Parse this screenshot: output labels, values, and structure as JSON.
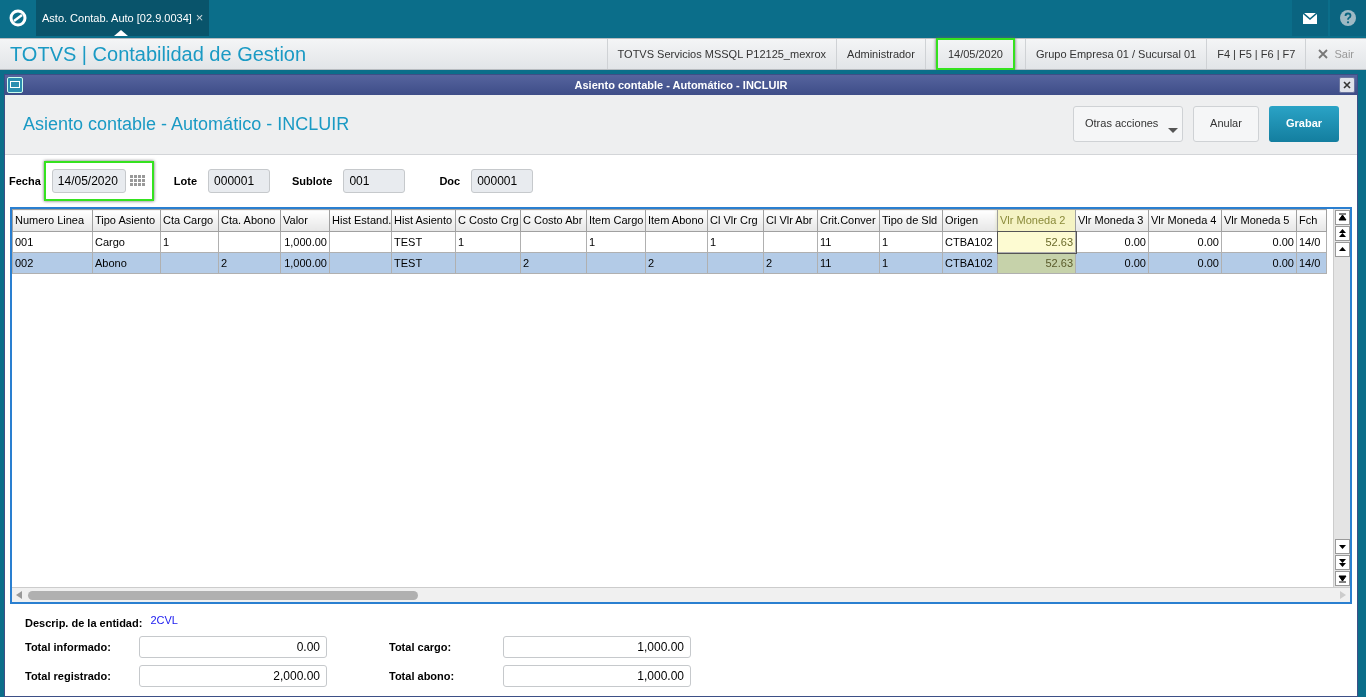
{
  "app_bar": {
    "tabs": [
      {
        "label": "Asto. Contab. Auto [02.9.0034]",
        "close": "×",
        "selected": true
      }
    ]
  },
  "header": {
    "title": "TOTVS | Contabilidad de Gestion",
    "items": [
      {
        "text": "TOTVS Servicios MSSQL P12125_mexrox",
        "highlighted": false
      },
      {
        "text": "Administrador",
        "highlighted": false
      },
      {
        "text": "14/05/2020",
        "highlighted": true
      },
      {
        "text": "Grupo Empresa 01 / Sucursal 01",
        "highlighted": false
      },
      {
        "text": "F4 | F5 | F6 | F7",
        "highlighted": false
      }
    ],
    "exit": "Sair"
  },
  "dialog": {
    "title": "Asiento contable - Automático - INCLUIR",
    "heading": "Asiento contable - Automático - INCLUIR",
    "buttons": [
      {
        "label": "Otras acciones",
        "kind": "menu"
      },
      {
        "label": "Anular",
        "kind": "plain"
      },
      {
        "label": "Grabar",
        "kind": "primary"
      }
    ]
  },
  "fields": [
    {
      "label": "Fecha",
      "value": "14/05/2020",
      "kind": "date",
      "highlighted": true
    },
    {
      "label": "Lote",
      "value": "000001",
      "kind": "text",
      "highlighted": false
    },
    {
      "label": "Sublote",
      "value": "001",
      "kind": "text",
      "highlighted": false
    },
    {
      "label": "Doc",
      "value": "000001",
      "kind": "text",
      "highlighted": false
    }
  ],
  "table": {
    "columns": [
      {
        "label": "Numero Linea",
        "kind": "text",
        "selected": false
      },
      {
        "label": "Tipo Asiento",
        "kind": "text",
        "selected": false
      },
      {
        "label": "Cta Cargo",
        "kind": "text",
        "selected": false
      },
      {
        "label": "Cta. Abono",
        "kind": "text",
        "selected": false
      },
      {
        "label": "Valor",
        "kind": "number",
        "selected": false
      },
      {
        "label": "Hist Estand.",
        "kind": "text",
        "selected": false
      },
      {
        "label": "Hist Asiento",
        "kind": "text",
        "selected": false
      },
      {
        "label": "C Costo Crg",
        "kind": "text",
        "selected": false
      },
      {
        "label": "C Costo Abr",
        "kind": "text",
        "selected": false
      },
      {
        "label": "Item Cargo",
        "kind": "text",
        "selected": false
      },
      {
        "label": "Item Abono",
        "kind": "text",
        "selected": false
      },
      {
        "label": "Cl Vlr Crg",
        "kind": "text",
        "selected": false
      },
      {
        "label": "Cl Vlr Abr",
        "kind": "text",
        "selected": false
      },
      {
        "label": "Crit.Conver",
        "kind": "text",
        "selected": false
      },
      {
        "label": "Tipo de Sld",
        "kind": "text",
        "selected": false
      },
      {
        "label": "Origen",
        "kind": "text",
        "selected": false
      },
      {
        "label": "Vlr Moneda 2",
        "kind": "number",
        "selected": true
      },
      {
        "label": "Vlr Moneda 3",
        "kind": "number",
        "selected": false
      },
      {
        "label": "Vlr Moneda 4",
        "kind": "number",
        "selected": false
      },
      {
        "label": "Vlr Moneda 5",
        "kind": "number",
        "selected": false
      },
      {
        "label": "Fch",
        "kind": "text",
        "selected": false
      }
    ],
    "rows": [
      {
        "selected": false,
        "cells": [
          "001",
          "Cargo",
          "1",
          "",
          "1,000.00",
          "",
          "TEST",
          "1",
          "",
          "1",
          "",
          "1",
          "",
          "11",
          "1",
          "CTBA102",
          "52.63",
          "0.00",
          "0.00",
          "0.00",
          "14/0"
        ]
      },
      {
        "selected": true,
        "cells": [
          "002",
          "Abono",
          "",
          "2",
          "1,000.00",
          "",
          "TEST",
          "",
          "2",
          "",
          "2",
          "",
          "2",
          "11",
          "1",
          "CTBA102",
          "52.63",
          "0.00",
          "0.00",
          "0.00",
          "14/0"
        ]
      }
    ]
  },
  "entity": {
    "label": "Descrip. de la entidad:",
    "value": "2CVL"
  },
  "totals": [
    {
      "label": "Total informado:",
      "value": "0.00"
    },
    {
      "label": "Total cargo:",
      "value": "1,000.00"
    },
    {
      "label": "Total registrado:",
      "value": "2,000.00"
    },
    {
      "label": "Total abono:",
      "value": "1,000.00"
    }
  ]
}
